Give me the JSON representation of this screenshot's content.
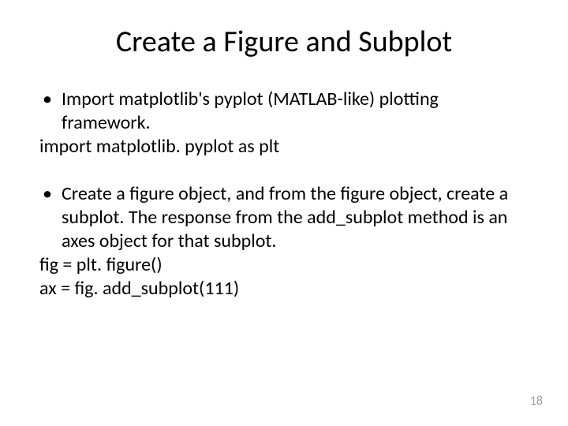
{
  "title": "Create a Figure and Subplot",
  "bullet1": "Import matplotlib's pyplot (MATLAB-like) plotting framework.",
  "code1": "import matplotlib. pyplot as plt",
  "bullet2": "Create a figure object, and from the figure object, create a subplot. The response from the add_subplot method is an axes object for that subplot.",
  "code2a": "fig = plt. figure()",
  "code2b": "ax = fig. add_subplot(111)",
  "pageNumber": "18"
}
